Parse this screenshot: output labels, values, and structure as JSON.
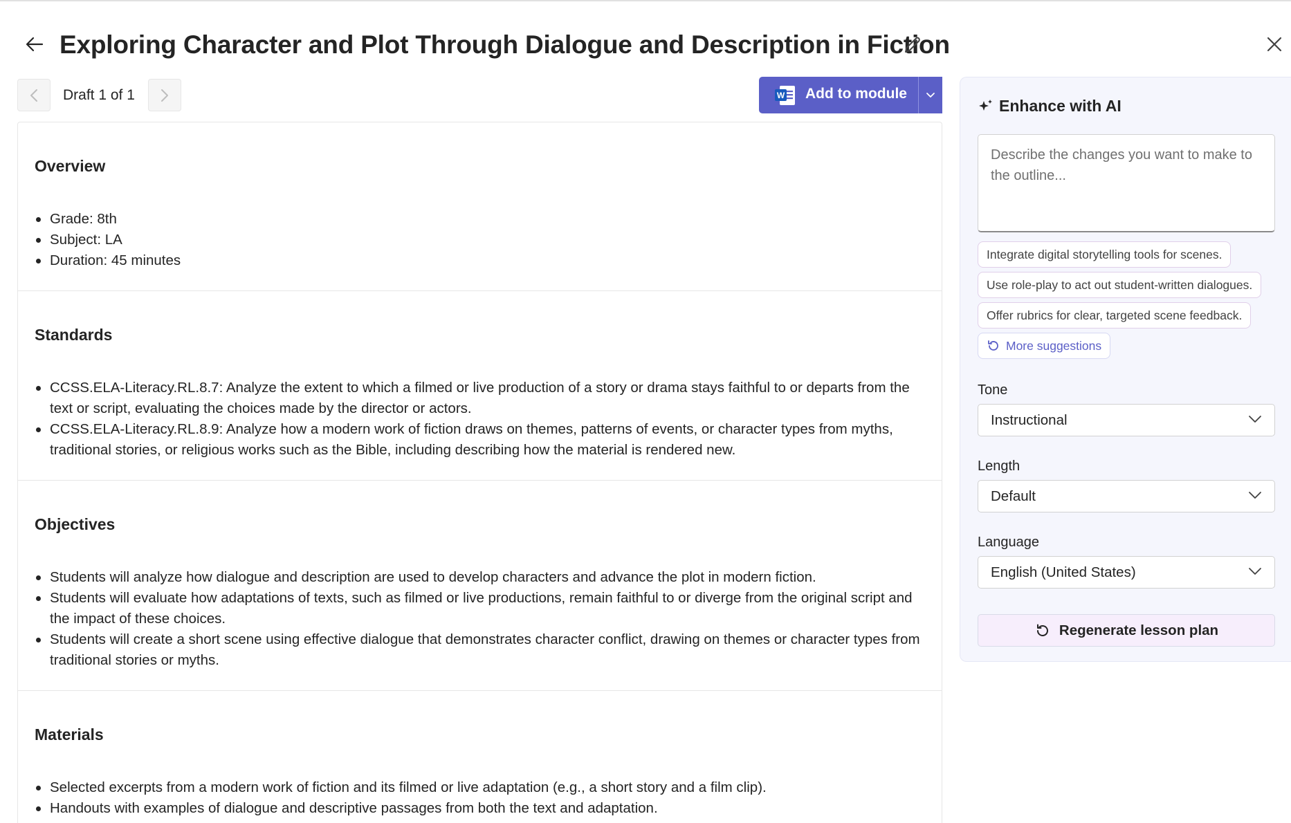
{
  "header": {
    "title": "Exploring Character and Plot Through Dialogue and Description in Fiction"
  },
  "draft_nav": {
    "label": "Draft 1 of 1"
  },
  "toolbar": {
    "add_label": "Add to module"
  },
  "sections": {
    "overview": {
      "heading": "Overview",
      "items": [
        "Grade: 8th",
        "Subject: LA",
        "Duration: 45 minutes"
      ]
    },
    "standards": {
      "heading": "Standards",
      "items": [
        "CCSS.ELA-Literacy.RL.8.7: Analyze the extent to which a filmed or live production of a story or drama stays faithful to or departs from the text or script, evaluating the choices made by the director or actors.",
        "CCSS.ELA-Literacy.RL.8.9: Analyze how a modern work of fiction draws on themes, patterns of events, or character types from myths, traditional stories, or religious works such as the Bible, including describing how the material is rendered new."
      ]
    },
    "objectives": {
      "heading": "Objectives",
      "items": [
        "Students will analyze how dialogue and description are used to develop characters and advance the plot in modern fiction.",
        "Students will evaluate how adaptations of texts, such as filmed or live productions, remain faithful to or diverge from the original script and the impact of these choices.",
        "Students will create a short scene using effective dialogue that demonstrates character conflict, drawing on themes or character types from traditional stories or myths."
      ]
    },
    "materials": {
      "heading": "Materials",
      "items": [
        "Selected excerpts from a modern work of fiction and its filmed or live adaptation (e.g., a short story and a film clip).",
        "Handouts with examples of dialogue and descriptive passages from both the text and adaptation."
      ]
    }
  },
  "ai_panel": {
    "title": "Enhance with AI",
    "placeholder": "Describe the changes you want to make to the outline...",
    "suggestions": [
      "Integrate digital storytelling tools for scenes.",
      "Use role-play to act out student-written dialogues.",
      "Offer rubrics for clear, targeted scene feedback."
    ],
    "more_label": "More suggestions",
    "tone": {
      "label": "Tone",
      "value": "Instructional"
    },
    "length": {
      "label": "Length",
      "value": "Default"
    },
    "language": {
      "label": "Language",
      "value": "English (United States)"
    },
    "regenerate_label": "Regenerate lesson plan"
  },
  "colors": {
    "accent": "#5b5fc7",
    "panel_bg": "#f5f6fd"
  }
}
